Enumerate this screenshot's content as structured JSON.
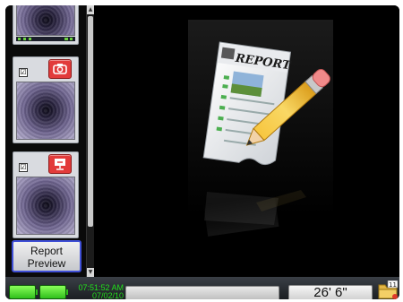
{
  "sidebar": {
    "thumbnails": [
      {
        "checked": true,
        "badge": "none"
      },
      {
        "checked": true,
        "badge": "camera-icon",
        "checkmark": "☑"
      },
      {
        "checked": true,
        "badge": "presentation-icon",
        "checkmark": "☑"
      }
    ],
    "report_preview": {
      "line1": "Report",
      "line2": "Preview"
    }
  },
  "main": {
    "artwork_title": "REPORT"
  },
  "status": {
    "time": "07:51:52 AM",
    "date": "07/02/10",
    "distance": "26' 6\"",
    "folder_count": "11",
    "message": ""
  },
  "colors": {
    "accent": "#3f4fd6",
    "battery": "#2fbf1b",
    "clock": "#22e01c",
    "badge": "#e23b3b"
  }
}
